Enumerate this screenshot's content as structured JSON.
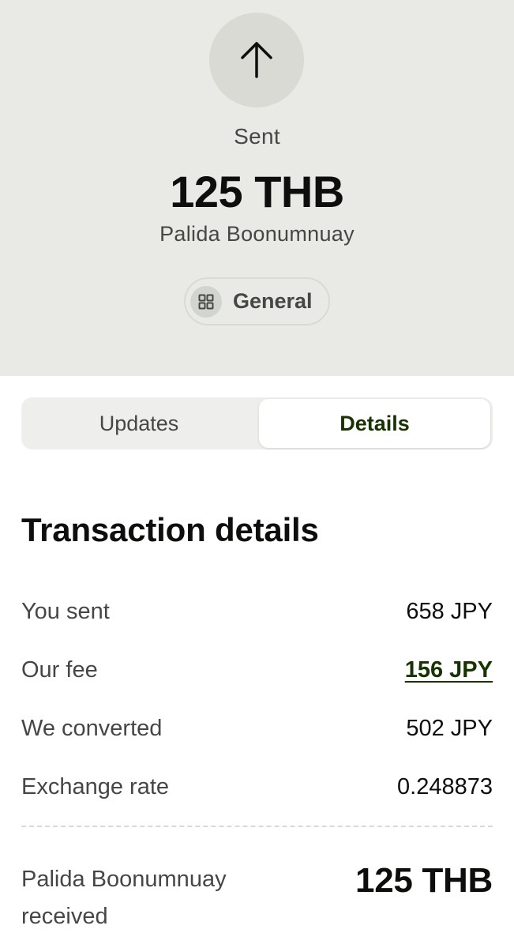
{
  "header": {
    "icon": "arrow-up-icon",
    "status": "Sent",
    "amount": "125 THB",
    "recipient": "Palida Boonumnuay",
    "category": {
      "icon": "grid-icon",
      "label": "General"
    }
  },
  "tabs": [
    {
      "label": "Updates",
      "selected": false
    },
    {
      "label": "Details",
      "selected": true
    }
  ],
  "details": {
    "title": "Transaction details",
    "rows": [
      {
        "label": "You sent",
        "value": "658 JPY"
      },
      {
        "label": "Our fee",
        "value": "156 JPY"
      },
      {
        "label": "We converted",
        "value": "502 JPY"
      },
      {
        "label": "Exchange rate",
        "value": "0.248873"
      }
    ],
    "received": {
      "label": "Palida Boonumnuay received",
      "value": "125 THB"
    }
  },
  "colors": {
    "hero_background": "#e9eae6",
    "accent_green": "#163300",
    "text_primary": "#0e0f0c",
    "text_secondary": "#454745"
  }
}
